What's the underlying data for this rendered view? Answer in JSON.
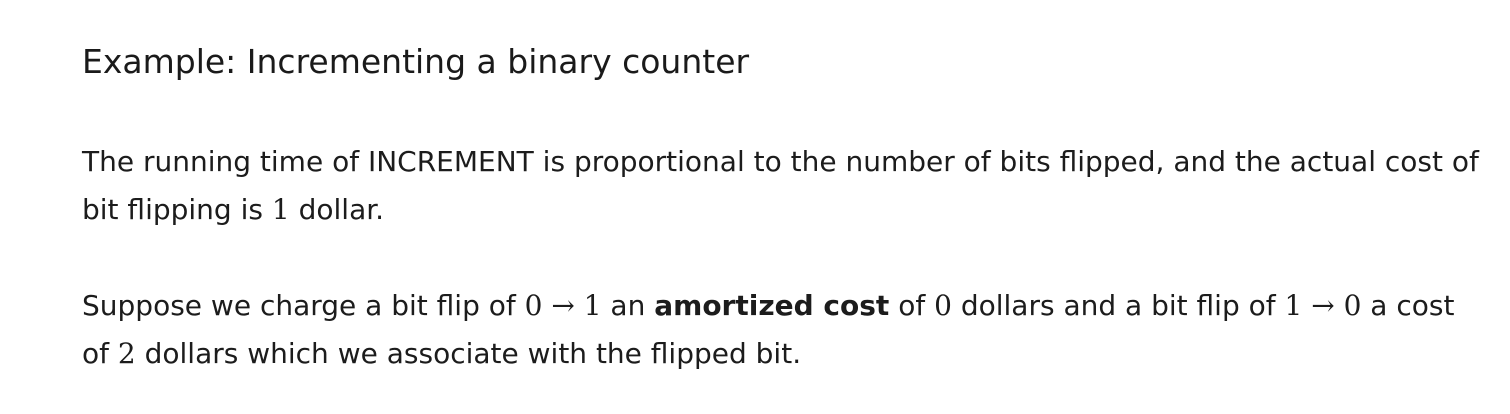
{
  "heading": "Example: Incrementing a binary counter",
  "paragraph1": {
    "t1": "The running time of INCREMENT is proportional to the number of bits flipped, and the actual cost of bit flipping is ",
    "m1": "1",
    "t2": " dollar."
  },
  "paragraph2": {
    "t1": "Suppose we charge a bit flip of ",
    "m1": "0 → 1",
    "t2": " an ",
    "b1": "amortized cost",
    "t3": " of ",
    "m2": "0",
    "t4": " dollars and a bit flip of ",
    "m3": "1 → 0",
    "t5": " a cost of ",
    "m4": "2",
    "t6": " dollars which we associate with the flipped bit."
  }
}
